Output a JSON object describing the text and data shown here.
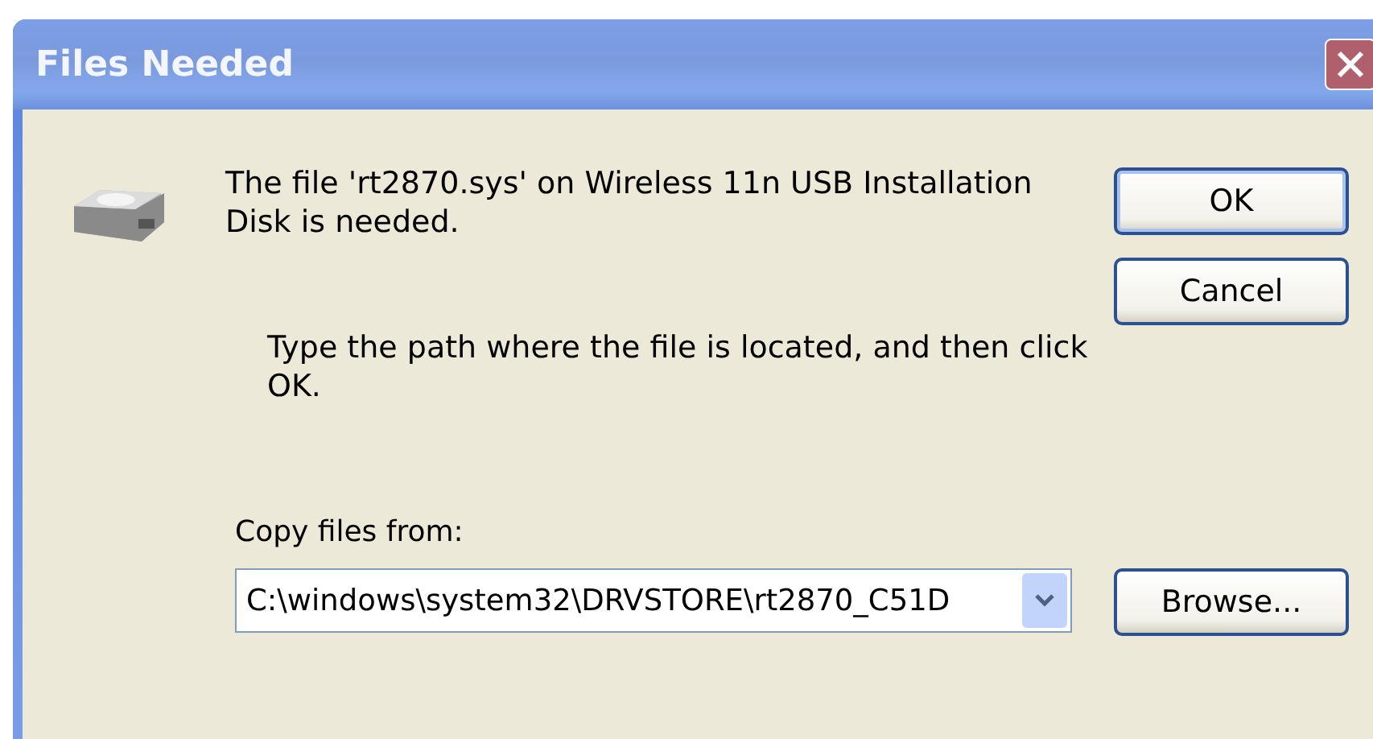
{
  "window": {
    "title": "Files Needed"
  },
  "message": "The file 'rt2870.sys' on Wireless 11n USB Installation Disk is needed.",
  "instruction": "Type the path where the file is located, and then click OK.",
  "copy_from": {
    "label": "Copy files from:",
    "value": "C:\\windows\\system32\\DRVSTORE\\rt2870_C51D"
  },
  "buttons": [
    {
      "label": "OK",
      "default": true
    },
    {
      "label": "Cancel",
      "default": false
    }
  ],
  "browse_button": "Browse..."
}
